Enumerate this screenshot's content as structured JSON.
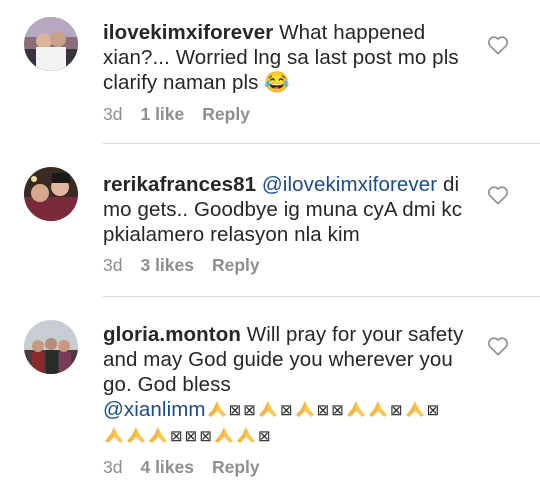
{
  "comments": [
    {
      "username": "ilovekimxiforever",
      "text": "What happened xian?... Worried lng sa last post mo pls clarify naman pls",
      "emoji": "😂",
      "time": "3d",
      "likes": "1 like",
      "reply": "Reply"
    },
    {
      "username": "rerikafrances81",
      "mention": "@ilovekimxiforever",
      "text": "di mo gets.. Goodbye ig muna cyA dmi kc pkialamero relasyon nla kim",
      "time": "3d",
      "likes": "3 likes",
      "reply": "Reply"
    },
    {
      "username": "gloria.monton",
      "text": "Will pray for your safety and may God guide you wherever you go. God bless",
      "mention": "@xianlimm",
      "box_char": "⊠",
      "time": "3d",
      "likes": "4 likes",
      "reply": "Reply"
    }
  ],
  "colors": {
    "text": "#262626",
    "meta": "#8e8e8e",
    "mention": "#1a4b8c",
    "divider": "#dbdbdb"
  },
  "icons": [
    "heart-outline-icon",
    "praying-hands-emoji",
    "tears-of-joy-emoji"
  ]
}
